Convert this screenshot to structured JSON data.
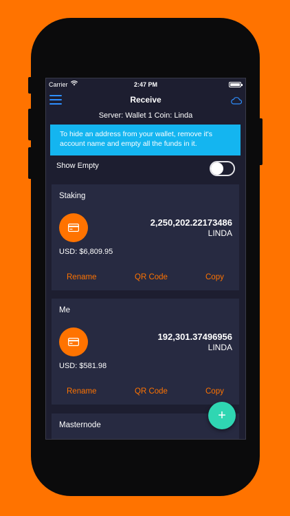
{
  "status_bar": {
    "carrier": "Carrier",
    "time": "2:47 PM"
  },
  "navbar": {
    "title": "Receive",
    "menu_icon": "hamburger-menu-icon",
    "cloud_icon": "cloud-icon"
  },
  "server_line": "Server: Wallet 1 Coin: Linda",
  "info_banner": "To hide an address from your wallet, remove it's account name and empty all the funds in it.",
  "show_empty": {
    "label": "Show Empty",
    "enabled": false
  },
  "colors": {
    "accent": "#ff7300",
    "banner": "#14b5f0",
    "fab": "#2fd6b2",
    "card_bg": "#272a41",
    "screen_bg": "#1d1e30",
    "nav_icons": "#2e8fff"
  },
  "accounts": [
    {
      "name": "Staking",
      "amount": "2,250,202.22173486",
      "unit": "LINDA",
      "usd": "USD: $6,809.95"
    },
    {
      "name": "Me",
      "amount": "192,301.37496956",
      "unit": "LINDA",
      "usd": "USD: $581.98"
    },
    {
      "name": "Masternode"
    }
  ],
  "actions": {
    "rename": "Rename",
    "qr_code": "QR Code",
    "copy": "Copy"
  },
  "fab": {
    "label": "+",
    "icon": "plus-icon"
  }
}
